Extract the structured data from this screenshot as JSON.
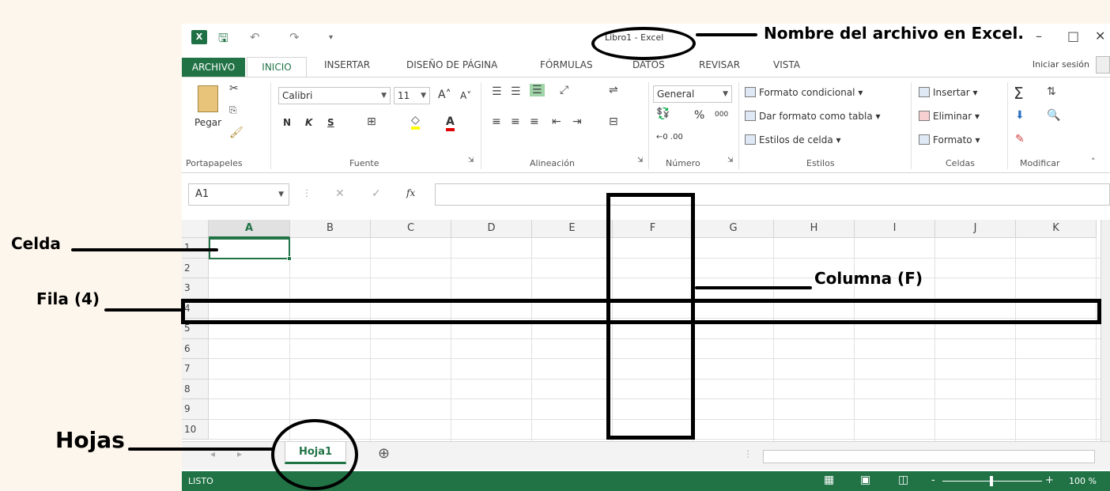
{
  "window": {
    "title": "Libro1 - Excel",
    "minimize": "–",
    "maximize": "□",
    "close": "✕"
  },
  "quick_access": {
    "save_icon": "save-icon",
    "undo": "↶",
    "redo": "↷",
    "customize": "▾"
  },
  "tabs": {
    "file": "ARCHIVO",
    "active": "INICIO",
    "items": [
      "INSERTAR",
      "DISEÑO DE PÁGINA",
      "FÓRMULAS",
      "DATOS",
      "REVISAR",
      "VISTA"
    ],
    "signin": "Iniciar sesión"
  },
  "ribbon": {
    "clipboard": {
      "paste": "Pegar",
      "label": "Portapapeles"
    },
    "font": {
      "name": "Calibri",
      "size": "11",
      "bold": "N",
      "italic": "K",
      "underline": "S",
      "label": "Fuente"
    },
    "alignment": {
      "label": "Alineación"
    },
    "number": {
      "format": "General",
      "percent": "%",
      "thousands": "000",
      "label": "Número"
    },
    "styles": {
      "conditional": "Formato condicional",
      "as_table": "Dar formato como tabla",
      "cell_styles": "Estilos de celda",
      "label": "Estilos"
    },
    "cells": {
      "insert": "Insertar",
      "delete": "Eliminar",
      "format": "Formato",
      "label": "Celdas"
    },
    "editing": {
      "sum": "Σ",
      "label": "Modificar"
    }
  },
  "formula_bar": {
    "name_box": "A1",
    "cancel": "✕",
    "enter": "✓",
    "fx": "fx"
  },
  "grid": {
    "columns": [
      "A",
      "B",
      "C",
      "D",
      "E",
      "F",
      "G",
      "H",
      "I",
      "J",
      "K"
    ],
    "rows": [
      "1",
      "2",
      "3",
      "4",
      "5",
      "6",
      "7",
      "8",
      "9",
      "10"
    ],
    "active_cell": "A1"
  },
  "sheets": {
    "tabs": [
      "Hoja1"
    ],
    "add": "⊕"
  },
  "status": {
    "mode": "LISTO",
    "zoom": "100 %",
    "zoom_minus": "-",
    "zoom_plus": "+"
  },
  "annotations": {
    "filename": "Nombre del archivo en Excel.",
    "column": "Columna (F)",
    "cell": "Celda",
    "row": "Fila (4)",
    "sheets": "Hojas"
  }
}
